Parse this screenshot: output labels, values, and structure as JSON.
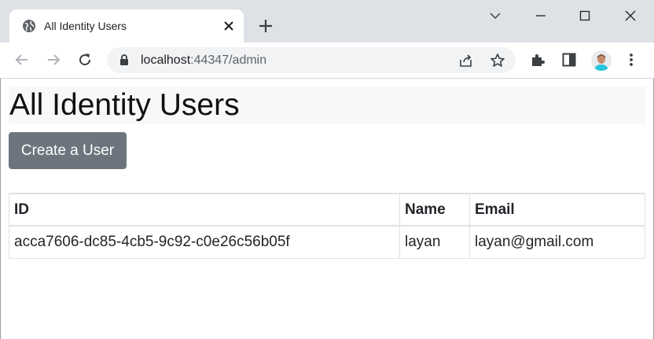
{
  "browser": {
    "tab": {
      "title": "All Identity Users"
    },
    "address": {
      "host": "localhost",
      "path": ":44347/admin"
    }
  },
  "page": {
    "title": "All Identity Users",
    "create_button": "Create a User",
    "table": {
      "columns": [
        "ID",
        "Name",
        "Email"
      ],
      "rows": [
        {
          "id": "acca7606-dc85-4cb5-9c92-c0e26c56b05f",
          "name": "layan",
          "email": "layan@gmail.com"
        }
      ]
    }
  },
  "colors": {
    "chrome_bg": "#dee1e6",
    "button_secondary": "#6c757d",
    "title_bg": "#f7f8fa"
  },
  "icons": [
    "globe-icon",
    "close-icon",
    "plus-icon",
    "chevron-down-icon",
    "minimize-icon",
    "maximize-icon",
    "window-close-icon",
    "back-arrow-icon",
    "forward-arrow-icon",
    "reload-icon",
    "lock-icon",
    "share-icon",
    "star-icon",
    "extensions-icon",
    "side-panel-icon",
    "profile-avatar",
    "kebab-menu-icon"
  ]
}
